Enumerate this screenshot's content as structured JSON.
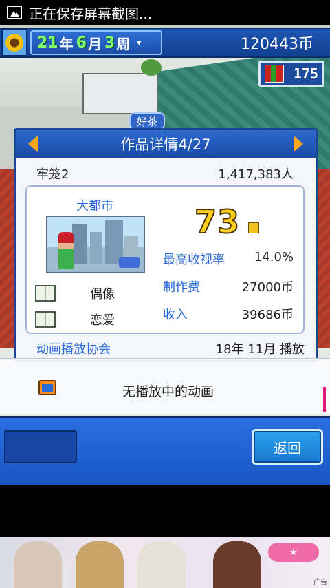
{
  "status_bar": {
    "notification": "正在保存屏幕截图..."
  },
  "header": {
    "year": "21",
    "year_unit": "年",
    "month": "6",
    "month_unit": "月",
    "week": "3",
    "week_unit": "周",
    "money": "120443币"
  },
  "research_points": "175",
  "staff_label": "好茶",
  "detail": {
    "title": "作品详情4/27",
    "work_name": "牢笼2",
    "viewers": "1,417,383人",
    "location": "大都市",
    "genres": [
      "偶像",
      "恋爱"
    ],
    "score": "73",
    "stats": [
      {
        "label": "最高收视率",
        "value": "14.0%"
      },
      {
        "label": "制作费",
        "value": "27000币"
      },
      {
        "label": "收入",
        "value": "39686币"
      }
    ],
    "studio": "动画播放协会",
    "airing": "18年 11月 播放"
  },
  "now_airing": "无播放中的动画",
  "back_label": "返回",
  "ad": {
    "tag": "广告"
  },
  "colors": {
    "accent_blue": "#2a6ad8",
    "header_blue": "#1d57b5",
    "arrow_orange": "#ffa81c",
    "score_yellow": "#ffcf1b"
  }
}
